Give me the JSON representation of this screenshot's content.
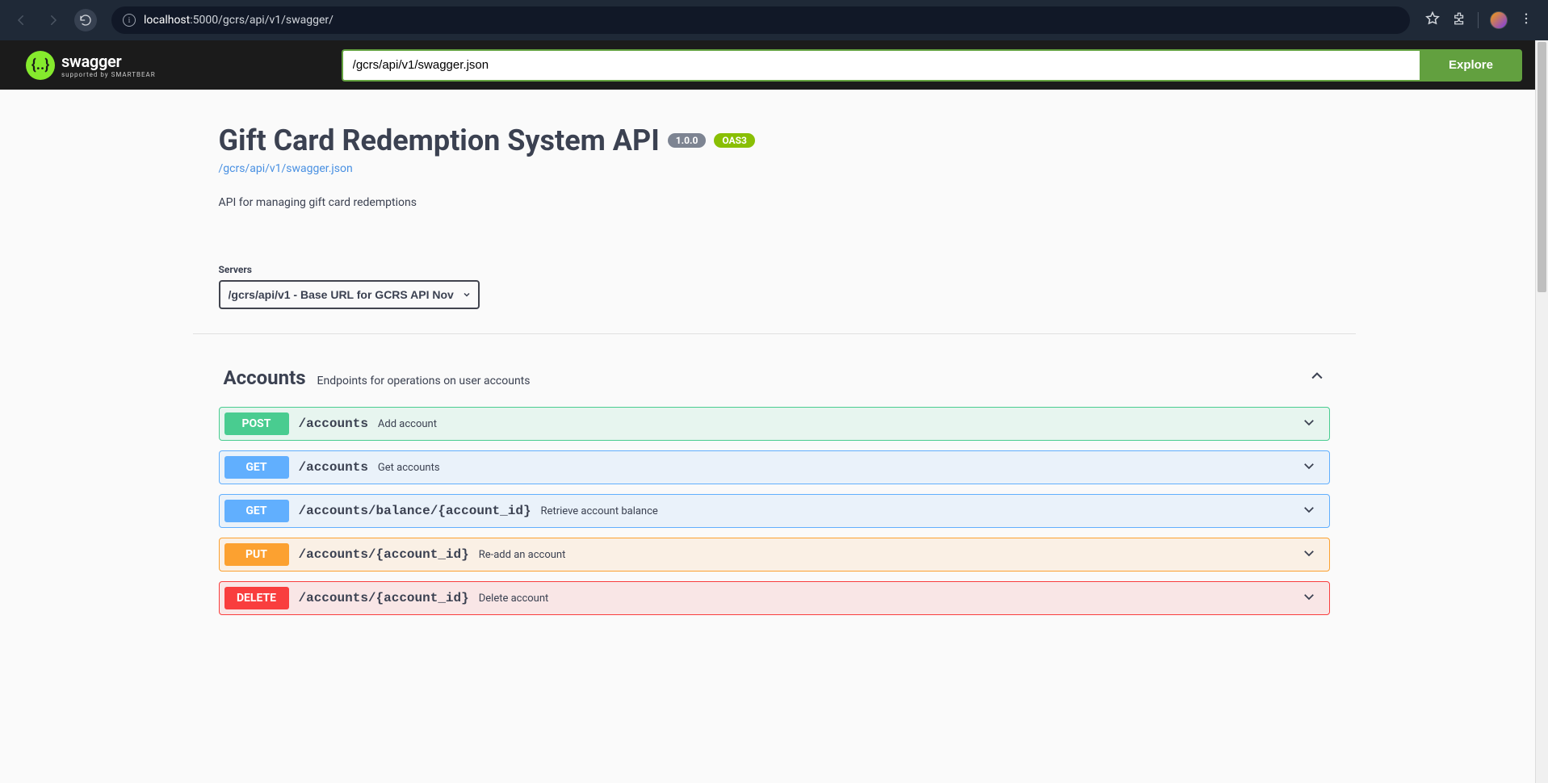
{
  "browser": {
    "url_host": "localhost",
    "url_path": ":5000/gcrs/api/v1/swagger/"
  },
  "topbar": {
    "logo_main": "swagger",
    "logo_sub": "supported by SMARTBEAR",
    "spec_input_value": "/gcrs/api/v1/swagger.json",
    "explore_label": "Explore"
  },
  "info": {
    "title": "Gift Card Redemption System API",
    "version": "1.0.0",
    "oas": "OAS3",
    "spec_link": "/gcrs/api/v1/swagger.json",
    "description": "API for managing gift card redemptions"
  },
  "servers": {
    "label": "Servers",
    "selected": "/gcrs/api/v1 - Base URL for GCRS API Nov"
  },
  "tag": {
    "name": "Accounts",
    "description": "Endpoints for operations on user accounts"
  },
  "operations": [
    {
      "method": "POST",
      "path": "/accounts",
      "summary": "Add account"
    },
    {
      "method": "GET",
      "path": "/accounts",
      "summary": "Get accounts"
    },
    {
      "method": "GET",
      "path": "/accounts/balance/{account_id}",
      "summary": "Retrieve account balance"
    },
    {
      "method": "PUT",
      "path": "/accounts/{account_id}",
      "summary": "Re-add an account"
    },
    {
      "method": "DELETE",
      "path": "/accounts/{account_id}",
      "summary": "Delete account"
    }
  ]
}
